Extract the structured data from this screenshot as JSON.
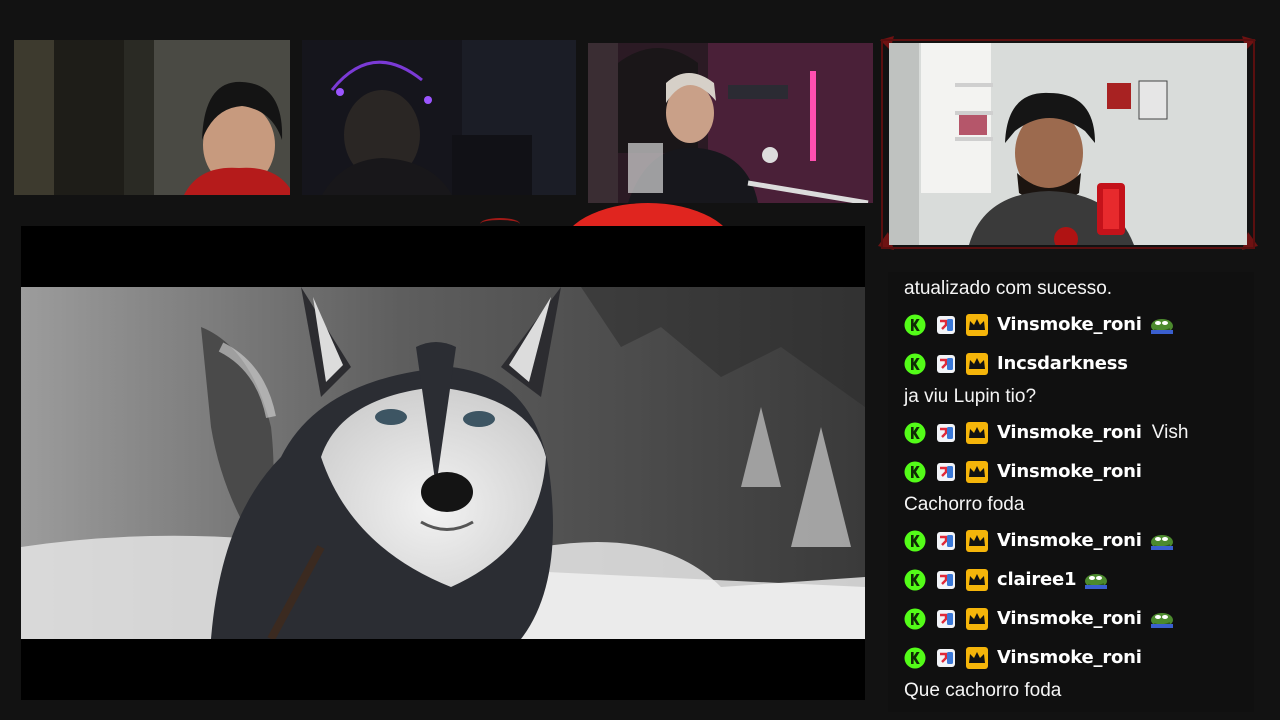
{
  "chat": {
    "messages": [
      {
        "type": "text",
        "text": "atualizado com sucesso."
      },
      {
        "type": "user",
        "username": "Vinsmoke_roni",
        "message": "",
        "emote": "pepe-emote"
      },
      {
        "type": "user",
        "username": "Incsdarkness",
        "message": "",
        "emote": ""
      },
      {
        "type": "text",
        "text": "ja viu Lupin tio?"
      },
      {
        "type": "user",
        "username": "Vinsmoke_roni",
        "message": "Vish",
        "emote": ""
      },
      {
        "type": "user",
        "username": "Vinsmoke_roni",
        "message": "",
        "emote": ""
      },
      {
        "type": "text",
        "text": "Cachorro foda"
      },
      {
        "type": "user",
        "username": "Vinsmoke_roni",
        "message": "",
        "emote": "pepe-emote"
      },
      {
        "type": "user",
        "username": "clairee1",
        "message": "",
        "emote": "pepe-emote"
      },
      {
        "type": "user",
        "username": "Vinsmoke_roni",
        "message": "",
        "emote": "pepe-emote"
      },
      {
        "type": "user",
        "username": "Vinsmoke_roni",
        "message": "",
        "emote": ""
      },
      {
        "type": "text",
        "text": "Que cachorro foda"
      }
    ]
  },
  "colors": {
    "background": "#121212",
    "accent_red": "#e0251f",
    "badge_green": "#53fc18",
    "badge_gold": "#f5b50a"
  }
}
